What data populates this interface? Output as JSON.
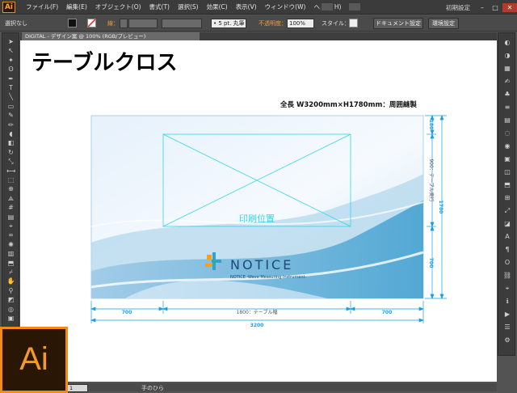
{
  "app": {
    "logo": "Ai",
    "menus": [
      "ファイル(F)",
      "編集(E)",
      "オブジェクト(O)",
      "書式(T)",
      "選択(S)",
      "効果(C)",
      "表示(V)",
      "ウィンドウ(W)",
      "ヘルプ(H)"
    ],
    "workspace": "初期設定",
    "big_logo": "Ai"
  },
  "control": {
    "selection": "選択なし",
    "stroke_label": "線：",
    "brush_value": "5 pt. 丸筆",
    "opacity_label": "不透明度：",
    "opacity_value": "100%",
    "style_label": "スタイル：",
    "doc_setup": "ドキュメント設定",
    "prefs": "環境設定"
  },
  "tab": {
    "title": "DIGITAL - デザイン案 @ 100% (RGB/プレビュー)"
  },
  "artboard": {
    "heading": "テーブルクロス",
    "spec": "全長 W3200mm×H1780mm：周囲縫製",
    "print_area": "印刷位置",
    "brand": "NOTICE",
    "brand_tagline": "NOTICE -Wave Measuring Instrument-",
    "dims": {
      "left": "700",
      "middle": "1800：テーブル幅",
      "right": "700",
      "total_width": "3200",
      "top_v": "180",
      "depth_v": "900：テーブル奥行",
      "bottom_v": "700",
      "total_height": "1780"
    }
  },
  "status": {
    "zoom": "1",
    "tool": "手のひら"
  },
  "colors": {
    "ai_orange": "#f28a14",
    "dim_blue": "#1a9fe0",
    "guide_cyan": "#33d6e6"
  }
}
